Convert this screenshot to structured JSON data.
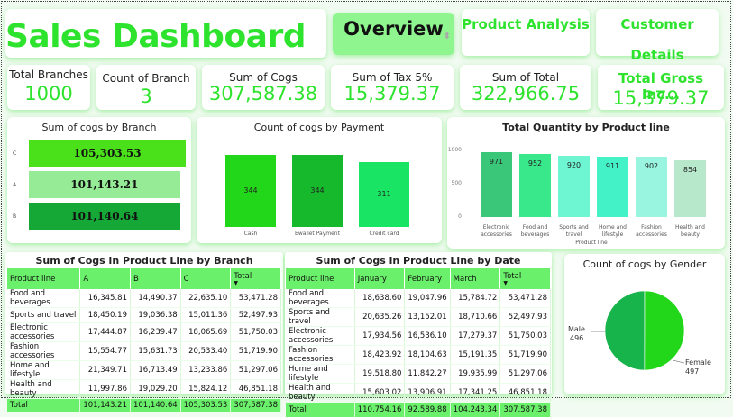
{
  "header": {
    "title": "Sales Dashboard",
    "nav": {
      "overview": "Overview",
      "product_analysis": "Product Analysis",
      "customer_details": "Customer Details"
    }
  },
  "kpis": {
    "total_branches": {
      "label": "Total Branches",
      "value": "1000"
    },
    "count_of_branch": {
      "label": "Count of Branch",
      "value": "3"
    },
    "sum_of_cogs": {
      "label": "Sum of Cogs",
      "value": "307,587.38"
    },
    "sum_of_tax": {
      "label": "Sum of Tax 5%",
      "value": "15,379.37"
    },
    "sum_of_total": {
      "label": "Sum of Total",
      "value": "322,966.75"
    },
    "total_gross_income": {
      "label": "Total Gross Inc...",
      "value": "15,379.37"
    }
  },
  "colors": {
    "accent": "#2ee32e",
    "header_green": "#6af06a",
    "overview_bg": "#8ff58f"
  },
  "chart_data": [
    {
      "type": "bar",
      "orientation": "horizontal",
      "title": "Sum of cogs by Branch",
      "categories": [
        "C",
        "A",
        "B"
      ],
      "values": [
        105303.53,
        101143.21,
        101140.64
      ],
      "labels": [
        "105,303.53",
        "101,143.21",
        "101,140.64"
      ],
      "colors": [
        "#4ae01a",
        "#96ec96",
        "#16a836"
      ]
    },
    {
      "type": "bar",
      "title": "Count of cogs by Payment",
      "categories": [
        "Cash",
        "Ewallet Payment",
        "Credit card"
      ],
      "values": [
        344,
        344,
        311
      ],
      "colors": [
        "#22d71a",
        "#16b92c",
        "#19e463"
      ]
    },
    {
      "type": "bar",
      "title": "Total Quantity by Product line",
      "xlabel": "Product line",
      "categories": [
        "Electronic accessories",
        "Food and beverages",
        "Sports and travel",
        "Home and lifestyle",
        "Fashion accessories",
        "Health and beauty"
      ],
      "values": [
        971,
        952,
        920,
        911,
        902,
        854
      ],
      "yticks": [
        "1000",
        "500",
        "0"
      ],
      "ylim": [
        0,
        1000
      ],
      "colors": [
        "#3ac77a",
        "#3ae88c",
        "#6ef5d2",
        "#44f2c8",
        "#99f5e0",
        "#b8e8cc"
      ]
    },
    {
      "type": "pie",
      "title": "Count of cogs by Gender",
      "categories": [
        "Male",
        "Female"
      ],
      "values": [
        496,
        497
      ],
      "colors": [
        "#16b44a",
        "#22d71a"
      ]
    }
  ],
  "branch_table": {
    "title": "Sum of Cogs in Product Line by Branch",
    "columns": [
      "Product line",
      "A",
      "B",
      "C",
      "Total"
    ],
    "rows": [
      [
        "Food and beverages",
        "16,345.81",
        "14,490.37",
        "22,635.10",
        "53,471.28"
      ],
      [
        "Sports and travel",
        "18,450.19",
        "19,036.38",
        "15,011.36",
        "52,497.93"
      ],
      [
        "Electronic accessories",
        "17,444.87",
        "16,239.47",
        "18,065.69",
        "51,750.03"
      ],
      [
        "Fashion accessories",
        "15,554.77",
        "15,631.73",
        "20,533.40",
        "51,719.90"
      ],
      [
        "Home and lifestyle",
        "21,349.71",
        "16,713.49",
        "13,233.86",
        "51,297.06"
      ],
      [
        "Health and beauty",
        "11,997.86",
        "19,029.20",
        "15,824.12",
        "46,851.18"
      ]
    ],
    "total": [
      "Total",
      "101,143.21",
      "101,140.64",
      "105,303.53",
      "307,587.38"
    ]
  },
  "date_table": {
    "title": "Sum of Cogs in Product Line by Date",
    "columns": [
      "Product line",
      "January",
      "February",
      "March",
      "Total"
    ],
    "rows": [
      [
        "Food and beverages",
        "18,638.60",
        "19,047.96",
        "15,784.72",
        "53,471.28"
      ],
      [
        "Sports and travel",
        "20,635.26",
        "13,152.01",
        "18,710.66",
        "52,497.93"
      ],
      [
        "Electronic accessories",
        "17,934.56",
        "16,536.10",
        "17,279.37",
        "51,750.03"
      ],
      [
        "Fashion accessories",
        "18,423.92",
        "18,104.63",
        "15,191.35",
        "51,719.90"
      ],
      [
        "Home and lifestyle",
        "19,518.80",
        "11,842.27",
        "19,935.99",
        "51,297.06"
      ],
      [
        "Health and beauty",
        "15,603.02",
        "13,906.91",
        "17,341.25",
        "46,851.18"
      ]
    ],
    "total": [
      "Total",
      "110,754.16",
      "92,589.88",
      "104,243.34",
      "307,587.38"
    ]
  }
}
